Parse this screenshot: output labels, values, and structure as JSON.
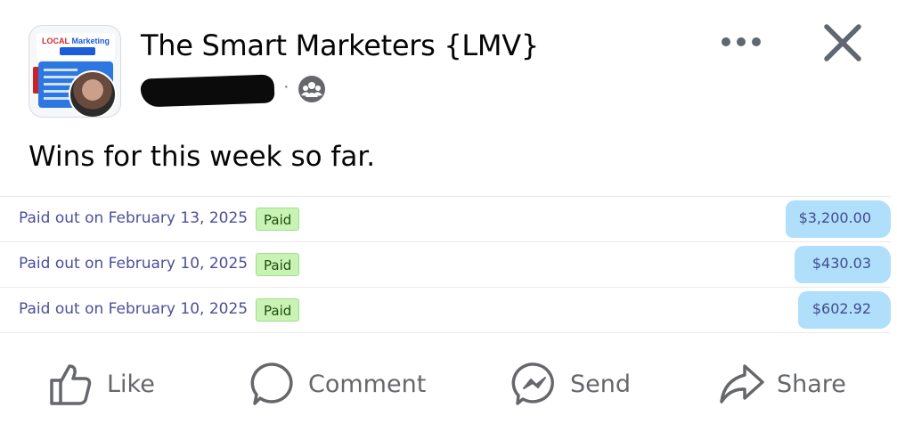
{
  "post": {
    "group_name": "The Smart Marketers {LMV}",
    "text": "Wins for this week so far.",
    "avatar_text": {
      "line1_a": "LOCAL",
      "line1_b": "Marketing",
      "line2": "VAULT",
      "line3": "WEEKLY"
    }
  },
  "header": {
    "more_icon": "more-horizontal-icon",
    "close_icon": "close-icon",
    "audience_icon": "group-icon"
  },
  "payouts": [
    {
      "description": "Paid out on February 13, 2025",
      "status": "Paid",
      "amount": "$3,200.00"
    },
    {
      "description": "Paid out on February 10, 2025",
      "status": "Paid",
      "amount": "$430.03"
    },
    {
      "description": "Paid out on February 10, 2025",
      "status": "Paid",
      "amount": "$602.92"
    }
  ],
  "actions": {
    "like": "Like",
    "comment": "Comment",
    "send": "Send",
    "share": "Share"
  },
  "colors": {
    "paid_badge": "#c9f3b4",
    "amount_highlight": "#a6dcfb",
    "payout_text": "#4b4f9a",
    "action_text": "#65676b"
  }
}
